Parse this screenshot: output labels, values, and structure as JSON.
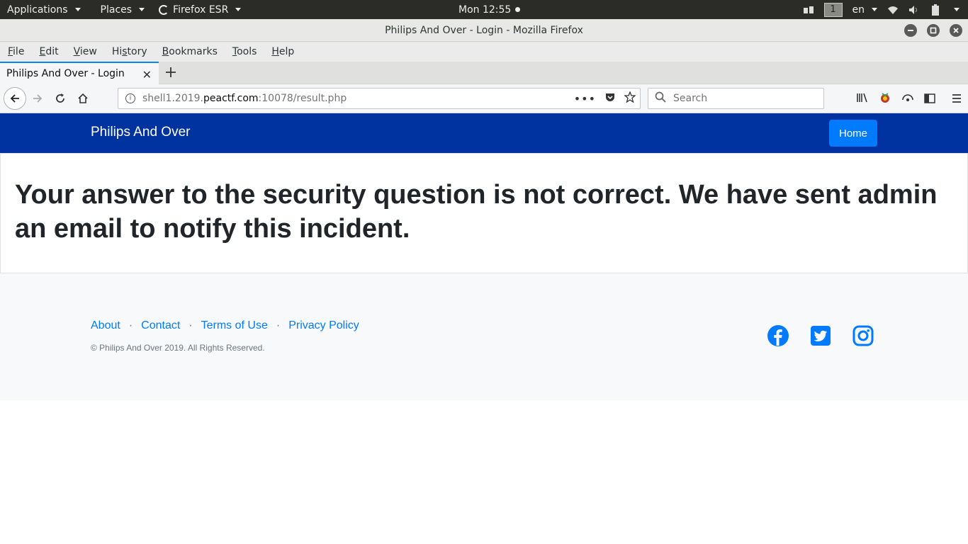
{
  "topbar": {
    "applications": "Applications",
    "places": "Places",
    "app_name": "Firefox ESR",
    "clock": "Mon 12:55",
    "workspace": "1",
    "language": "en"
  },
  "window": {
    "title": "Philips And Over - Login - Mozilla Firefox"
  },
  "menubar": {
    "items": [
      {
        "label": "File",
        "key": "F",
        "rest": "ile"
      },
      {
        "label": "Edit",
        "key": "E",
        "rest": "dit"
      },
      {
        "label": "View",
        "key": "V",
        "rest": "iew"
      },
      {
        "label": "History",
        "pre": "Hi",
        "key": "s",
        "rest": "tory"
      },
      {
        "label": "Bookmarks",
        "key": "B",
        "rest": "ookmarks"
      },
      {
        "label": "Tools",
        "key": "T",
        "rest": "ools"
      },
      {
        "label": "Help",
        "key": "H",
        "rest": "elp"
      }
    ]
  },
  "tab": {
    "title": "Philips And Over - Login"
  },
  "urlbar": {
    "prefix": "shell1.2019.",
    "domain": "peactf.com",
    "suffix": ":10078/result.php"
  },
  "searchbar": {
    "placeholder": "Search"
  },
  "site": {
    "brand": "Philips And Over",
    "home_button": "Home",
    "message": "Your answer to the security question is not correct. We have sent admin an email to notify this incident.",
    "footer_links": [
      "About",
      "Contact",
      "Terms of Use",
      "Privacy Policy"
    ],
    "separator": "·",
    "copyright": "© Philips And Over 2019. All Rights Reserved.",
    "social_icons": [
      "facebook-icon",
      "twitter-icon",
      "instagram-icon"
    ],
    "colors": {
      "navbar": "#0033a0",
      "button": "#007bff",
      "link": "#007bff"
    }
  }
}
